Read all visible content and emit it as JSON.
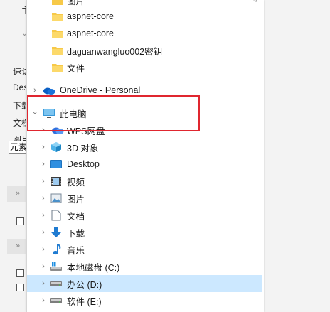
{
  "background": {
    "labels": [
      "主",
      "速访",
      "Des",
      "下载",
      "文档",
      "图片"
    ],
    "element_box": "元素"
  },
  "tree": {
    "top_partial": "图片",
    "items": [
      {
        "label": "aspnet-core",
        "icon": "folder-icon"
      },
      {
        "label": "aspnet-core",
        "icon": "folder-icon"
      },
      {
        "label": "daguanwangluo002密钥",
        "icon": "folder-icon"
      },
      {
        "label": "文件",
        "icon": "folder-icon"
      },
      {
        "label": "OneDrive - Personal",
        "icon": "onedrive-cloud-icon"
      },
      {
        "label": "此电脑",
        "icon": "this-pc-icon"
      },
      {
        "label": "WPS网盘",
        "icon": "wps-cloud-icon"
      },
      {
        "label": "3D 对象",
        "icon": "3d-objects-icon"
      },
      {
        "label": "Desktop",
        "icon": "desktop-icon"
      },
      {
        "label": "视频",
        "icon": "video-icon"
      },
      {
        "label": "图片",
        "icon": "pictures-icon"
      },
      {
        "label": "文档",
        "icon": "documents-icon"
      },
      {
        "label": "下载",
        "icon": "download-icon"
      },
      {
        "label": "音乐",
        "icon": "music-icon"
      },
      {
        "label": "本地磁盘 (C:)",
        "icon": "windows-drive-icon"
      },
      {
        "label": "办公 (D:)",
        "icon": "drive-icon"
      },
      {
        "label": "软件 (E:)",
        "icon": "drive-icon"
      }
    ]
  },
  "colors": {
    "selection": "#cce8ff",
    "highlight_border": "#e0262f",
    "folder": "#f7c948"
  }
}
